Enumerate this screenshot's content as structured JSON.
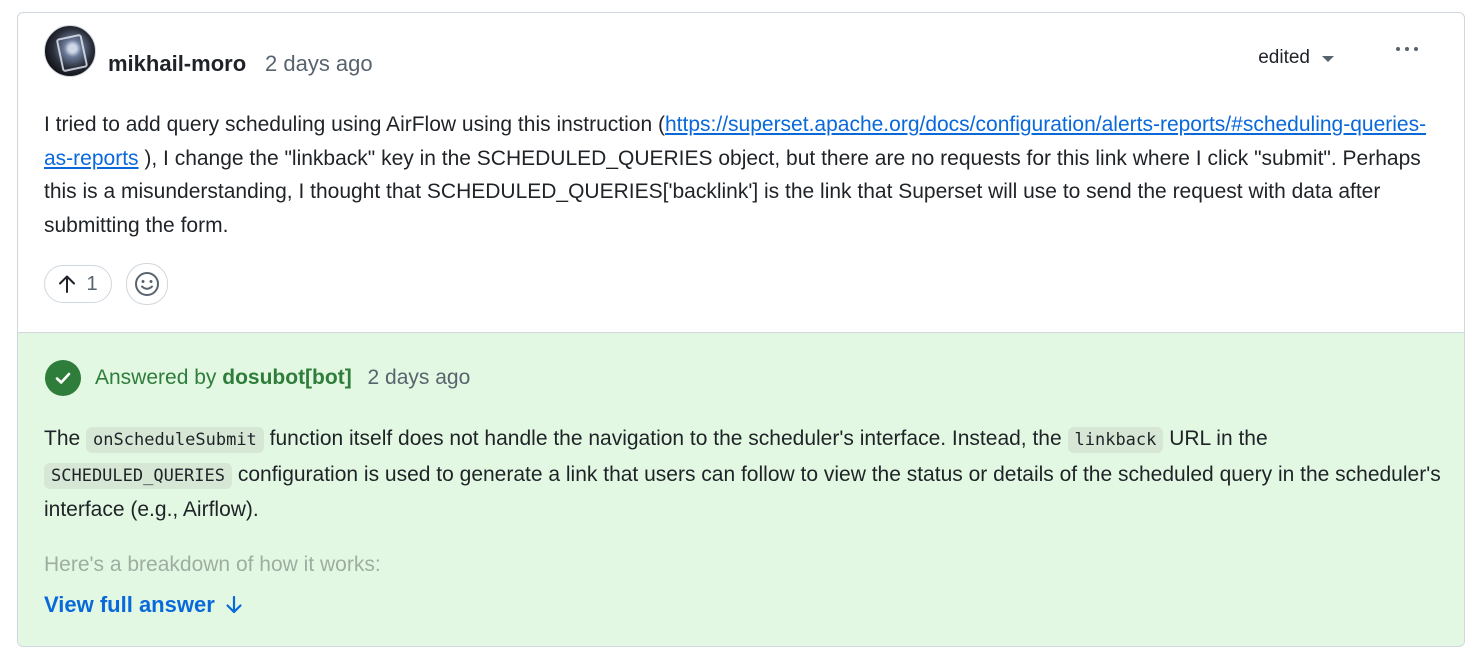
{
  "comment": {
    "author": "mikhail-moro",
    "time": "2 days ago",
    "edited_label": "edited",
    "text_part1": "I tried to add query scheduling using AirFlow using this instruction (",
    "link": "https://superset.apache.org/docs/configuration/alerts-reports/#scheduling-queries-as-reports",
    "text_part2": " ), I change the \"linkback\" key in the SCHEDULED_QUERIES object, but there are no requests for this link where I click \"submit\". Perhaps this is a misunderstanding, I thought that SCHEDULED_QUERIES['backlink'] is the link that Superset will use to send the request with data after submitting the form.",
    "upvote_count": "1"
  },
  "answer": {
    "prefix": "Answered by",
    "bot": "dosubot[bot]",
    "time": "2 days ago",
    "t1": "The ",
    "code1": "onScheduleSubmit",
    "t2": " function itself does not handle the navigation to the scheduler's interface. Instead, the ",
    "code2": "linkback",
    "t3": " URL in the ",
    "code3": "SCHEDULED_QUERIES",
    "t4": " configuration is used to generate a link that users can follow to view the status or details of the scheduled query in the scheduler's interface (e.g., Airflow).",
    "faded_text": "Here's a breakdown of how it works:",
    "view_full": "View full answer"
  },
  "colors": {
    "answer_bg": "#e2f8e2",
    "accent_green": "#2f7d3b",
    "link_blue": "#0969da"
  },
  "icons": [
    "kebab-horizontal-icon",
    "triangle-down-icon",
    "arrow-up-icon",
    "smiley-icon",
    "check-circle-icon",
    "arrow-down-icon"
  ]
}
